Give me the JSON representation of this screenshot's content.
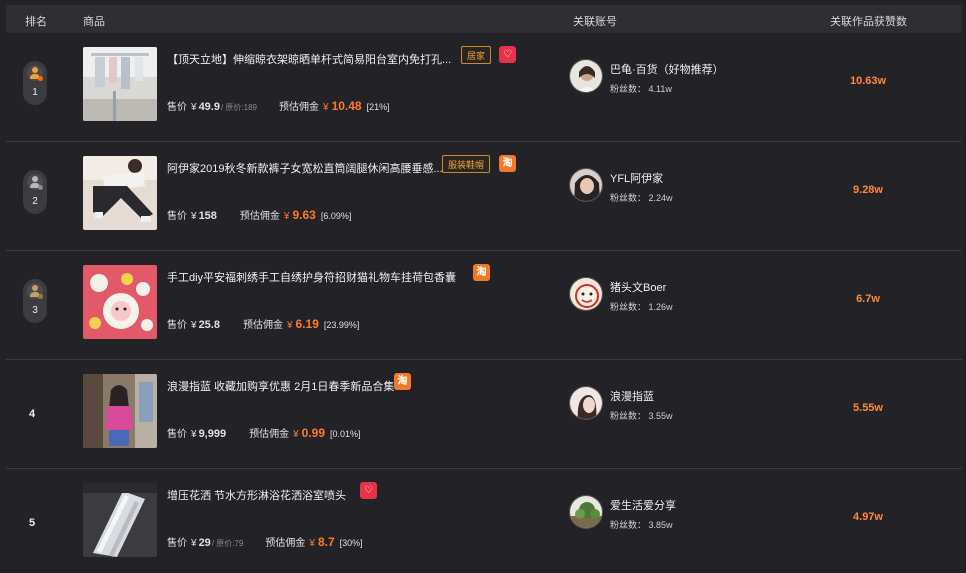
{
  "header": {
    "rank": "排名",
    "product": "商品",
    "account": "关联账号",
    "likes": "关联作品获赞数"
  },
  "colors": {
    "accent": "#ff7a2e",
    "tag_border": "#c88a33",
    "tmall": "#e8324a",
    "taobao": "#f2792a",
    "medal_gold": "#f0a23a",
    "medal_silver": "#b8b8c0",
    "medal_bronze": "#c8a060"
  },
  "rows": [
    {
      "rank": "1",
      "title": "【顶天立地】伸缩晾衣架晾晒单杆式简易阳台室内免打孔...",
      "tag": "居家",
      "platform": "tmall-icon",
      "price_label": "售价",
      "yen": "¥",
      "price": "49.9",
      "orig_price": "/ 原价:189",
      "commission_label": "预估佣金",
      "commission_yen": "¥",
      "commission": "10.48",
      "commission_pct": "[21%]",
      "account_name": "巴龟·百货（好物推荐）",
      "fans": "粉丝数： 4.11w",
      "likes": "10.63w"
    },
    {
      "rank": "2",
      "title": "阿伊家2019秋冬新款裤子女宽松直筒阔腿休闲高腰垂感...",
      "tag": "服装鞋帽",
      "platform": "taobao-icon",
      "price_label": "售价",
      "yen": "¥",
      "price": "158",
      "orig_price": "",
      "commission_label": "预估佣金",
      "commission_yen": "¥",
      "commission": "9.63",
      "commission_pct": "[6.09%]",
      "account_name": "YFL阿伊家",
      "fans": "粉丝数： 2.24w",
      "likes": "9.28w"
    },
    {
      "rank": "3",
      "title": "手工diy平安福刺绣手工自绣护身符招财猫礼物车挂荷包香囊...",
      "tag": "",
      "platform": "taobao-icon",
      "price_label": "售价",
      "yen": "¥",
      "price": "25.8",
      "orig_price": "",
      "commission_label": "预估佣金",
      "commission_yen": "¥",
      "commission": "6.19",
      "commission_pct": "[23.99%]",
      "account_name": "猪头文Boer",
      "fans": "粉丝数： 1.26w",
      "likes": "6.7w"
    },
    {
      "rank": "4",
      "title": "浪漫指蓝 收藏加购享优惠 2月1日春季新品合集",
      "tag": "",
      "platform": "taobao-icon",
      "price_label": "售价",
      "yen": "¥",
      "price": "9,999",
      "orig_price": "",
      "commission_label": "预估佣金",
      "commission_yen": "¥",
      "commission": "0.99",
      "commission_pct": "[0.01%]",
      "account_name": "浪漫指蓝",
      "fans": "粉丝数： 3.55w",
      "likes": "5.55w"
    },
    {
      "rank": "5",
      "title": "增压花洒 节水方形淋浴花洒浴室喷头",
      "tag": "",
      "platform": "tmall-icon",
      "price_label": "售价",
      "yen": "¥",
      "price": "29",
      "orig_price": "/ 原价:79",
      "commission_label": "预估佣金",
      "commission_yen": "¥",
      "commission": "8.7",
      "commission_pct": "[30%]",
      "account_name": "爱生活爱分享",
      "fans": "粉丝数： 3.85w",
      "likes": "4.97w"
    }
  ]
}
